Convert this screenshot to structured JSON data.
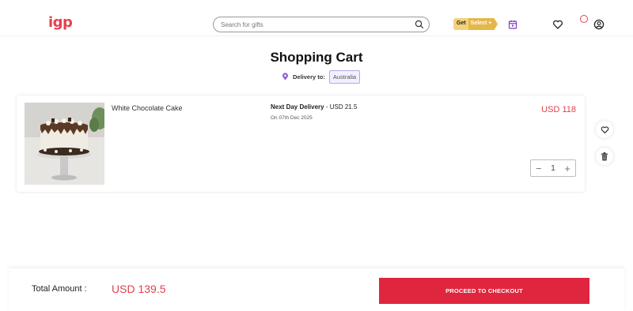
{
  "header": {
    "logo": "igp",
    "search_placeholder": "Search for gifts",
    "select_badge_get": "Get",
    "select_badge_word": "Select +",
    "notification_count": "",
    "icons": [
      "search-icon",
      "calendar-icon",
      "heart-icon",
      "notification-icon",
      "user-icon"
    ]
  },
  "page": {
    "title": "Shopping Cart",
    "delivery_label": "Delivery to:",
    "delivery_country": "Australia"
  },
  "cart": {
    "items": [
      {
        "name": "White Chocolate Cake",
        "delivery_type": "Next Day Delivery",
        "delivery_fee": " - USD 21.5",
        "delivery_date": "On 07th Dec 2025",
        "price": "USD 118",
        "quantity": "1"
      }
    ]
  },
  "footer": {
    "total_label": "Total Amount :",
    "total_value": "USD 139.5",
    "checkout_label": "PROCEED TO CHECKOUT"
  },
  "colors": {
    "brand": "#e5404e",
    "checkout": "#e0263f",
    "chip_border": "#b9a6e8"
  }
}
